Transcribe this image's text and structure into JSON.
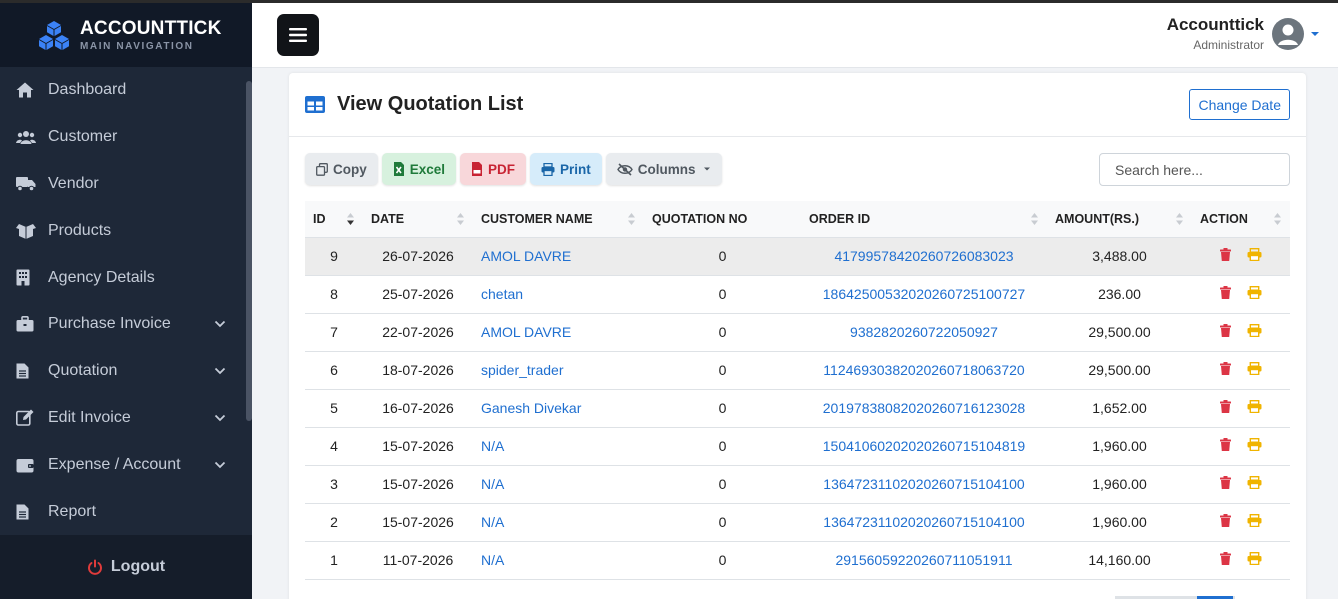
{
  "brand": {
    "title": "ACCOUNTTICK",
    "subtitle": "MAIN NAVIGATION",
    "logo_icon": "cubes-icon"
  },
  "sidebar": {
    "items": [
      {
        "label": "Dashboard",
        "icon": "home-icon",
        "has_submenu": false
      },
      {
        "label": "Customer",
        "icon": "users-icon",
        "has_submenu": false
      },
      {
        "label": "Vendor",
        "icon": "truck-icon",
        "has_submenu": false
      },
      {
        "label": "Products",
        "icon": "boxes-icon",
        "has_submenu": false
      },
      {
        "label": "Agency Details",
        "icon": "building-icon",
        "has_submenu": false
      },
      {
        "label": "Purchase Invoice",
        "icon": "briefcase-icon",
        "has_submenu": true
      },
      {
        "label": "Quotation",
        "icon": "file-icon",
        "has_submenu": true
      },
      {
        "label": "Edit Invoice",
        "icon": "edit-icon",
        "has_submenu": true
      },
      {
        "label": "Expense / Account",
        "icon": "wallet-icon",
        "has_submenu": true
      },
      {
        "label": "Report",
        "icon": "file-icon",
        "has_submenu": false
      }
    ],
    "logout_label": "Logout"
  },
  "header": {
    "user_name": "Accounttick",
    "user_role": "Administrator"
  },
  "card": {
    "title": "View Quotation List",
    "change_date_label": "Change Date",
    "toolbar": {
      "copy": "Copy",
      "excel": "Excel",
      "pdf": "PDF",
      "print": "Print",
      "columns": "Columns"
    },
    "search_placeholder": "Search here...",
    "columns": [
      "ID",
      "DATE",
      "CUSTOMER NAME",
      "QUOTATION NO",
      "ORDER ID",
      "AMOUNT(RS.)",
      "ACTION"
    ],
    "rows": [
      {
        "id": "9",
        "date": "26-07-2026",
        "customer": "AMOL DAVRE",
        "quotation_no": "0",
        "order_id": "41799578420260726083023",
        "amount": "3,488.00"
      },
      {
        "id": "8",
        "date": "25-07-2026",
        "customer": "chetan",
        "quotation_no": "0",
        "order_id": "18642500532020260725100727",
        "amount": "236.00"
      },
      {
        "id": "7",
        "date": "22-07-2026",
        "customer": "AMOL DAVRE",
        "quotation_no": "0",
        "order_id": "9382820260722050927",
        "amount": "29,500.00"
      },
      {
        "id": "6",
        "date": "18-07-2026",
        "customer": "spider_trader",
        "quotation_no": "0",
        "order_id": "11246930382020260718063720",
        "amount": "29,500.00"
      },
      {
        "id": "5",
        "date": "16-07-2026",
        "customer": "Ganesh Divekar",
        "quotation_no": "0",
        "order_id": "20197838082020260716123028",
        "amount": "1,652.00"
      },
      {
        "id": "4",
        "date": "15-07-2026",
        "customer": "N/A",
        "quotation_no": "0",
        "order_id": "15041060202020260715104819",
        "amount": "1,960.00"
      },
      {
        "id": "3",
        "date": "15-07-2026",
        "customer": "N/A",
        "quotation_no": "0",
        "order_id": "13647231102020260715104100",
        "amount": "1,960.00"
      },
      {
        "id": "2",
        "date": "15-07-2026",
        "customer": "N/A",
        "quotation_no": "0",
        "order_id": "13647231102020260715104100",
        "amount": "1,960.00"
      },
      {
        "id": "1",
        "date": "11-07-2026",
        "customer": "N/A",
        "quotation_no": "0",
        "order_id": "29156059220260711051911",
        "amount": "14,160.00"
      }
    ],
    "highlighted_row": 0
  },
  "colors": {
    "link": "#1f6fd0",
    "delete": "#dc3545",
    "print": "#f0b400",
    "sidebar_bg": "#1e2838",
    "brand_blue": "#3b82f6"
  }
}
